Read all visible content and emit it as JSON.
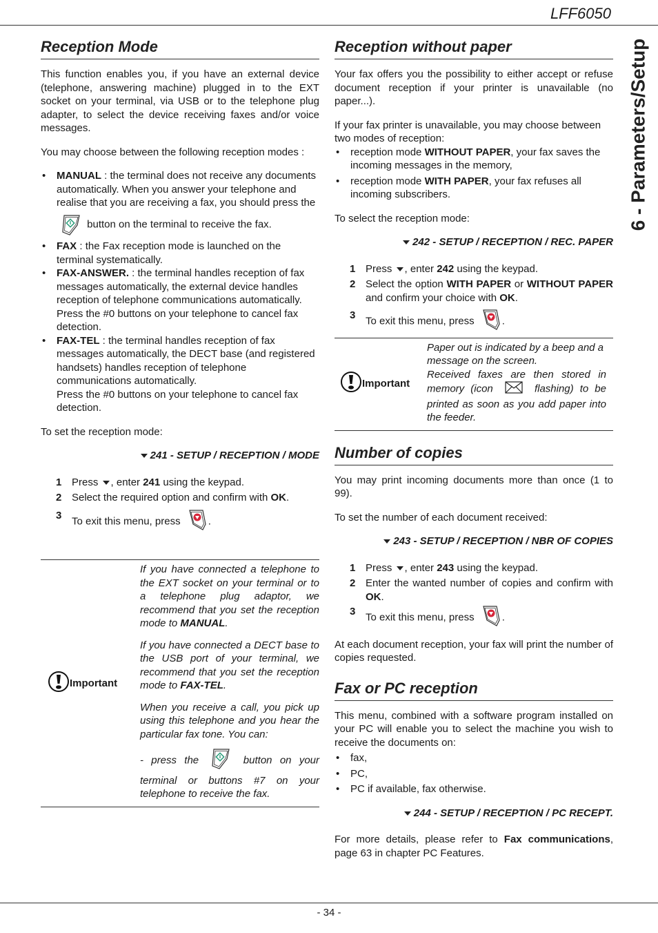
{
  "header": {
    "model": "LFF6050",
    "chapter_tab": "6 - Parameters/Setup"
  },
  "footer": {
    "page_number": "- 34 -"
  },
  "left": {
    "title": "Reception Mode",
    "intro": "This function enables you, if you have an external device (telephone, answering machine) plugged in to the EXT socket on your terminal, via USB or to the telephone plug adapter, to select the device receiving faxes and/or voice messages.",
    "choose": "You may choose between the following reception modes :",
    "modes": [
      {
        "name": "MANUAL",
        "text_a": " : the terminal does not receive any documents automatically. When you answer your telephone and realise that you are receiving a fax, you should press the",
        "text_b": " button on the terminal to receive the fax."
      },
      {
        "name": "FAX",
        "text": " : the Fax reception mode is launched on the terminal systematically."
      },
      {
        "name": "FAX-ANSWER.",
        "text": " : the terminal handles reception of fax messages automatically, the external device handles reception of telephone communications automatically. Press the #0 buttons on your telephone to cancel fax detection."
      },
      {
        "name": "FAX-TEL",
        "text": " : the terminal handles reception of fax messages automatically, the DECT base (and registered handsets) handles reception of telephone communications automatically.",
        "text2": "Press the #0 buttons on your telephone to cancel fax detection."
      }
    ],
    "set_mode": "To set the reception mode:",
    "menu_path": "241 - SETUP / RECEPTION / MODE",
    "steps": [
      {
        "n": "1",
        "a": "Press",
        "b": ", enter ",
        "bold": "241",
        "c": " using the keypad."
      },
      {
        "n": "2",
        "a": "Select the required option and confirm with ",
        "bold": "OK",
        "c": "."
      },
      {
        "n": "3",
        "a": "To exit this menu, press",
        "c": "."
      }
    ],
    "important": {
      "label": "Important",
      "p1_a": "If you have connected a telephone to the EXT socket on your terminal or to a telephone plug adaptor, we recommend that you set the reception mode to ",
      "p1_bold": "MANUAL",
      "p2_a": "If you have connected a DECT base to the USB port of your terminal, we recommend that you set the reception mode to ",
      "p2_bold": "FAX-TEL",
      "p3": "When you receive a call, you pick up using this telephone and you hear the particular fax tone. You can:",
      "p4_a": "- press the",
      "p4_b": " button on your terminal or buttons #7 on your telephone to receive the fax."
    }
  },
  "right": {
    "s1": {
      "title": "Reception without paper",
      "intro": "Your fax offers you the possibility to either accept or refuse document reception if your printer is unavailable (no paper...).",
      "choose": "If your fax printer is unavailable, you may choose between two modes of reception:",
      "opts": [
        {
          "a": "reception mode ",
          "bold": "WITHOUT PAPER",
          "c": ", your fax saves the incoming messages in the memory,"
        },
        {
          "a": "reception mode ",
          "bold": "WITH PAPER",
          "c": ", your fax refuses all incoming subscribers."
        }
      ],
      "select": "To select the reception mode:",
      "menu_path": "242 - SETUP / RECEPTION / REC. PAPER",
      "steps": [
        {
          "n": "1",
          "a": "Press",
          "b": ", enter ",
          "bold": "242",
          "c": " using the keypad."
        },
        {
          "n": "2",
          "a": "Select the option ",
          "bold1": "WITH PAPER",
          "mid": " or ",
          "bold2": "WITHOUT PAPER",
          "c1": " and confirm your choice with ",
          "bold3": "OK",
          "c": "."
        },
        {
          "n": "3",
          "a": "To exit this menu, press",
          "c": "."
        }
      ],
      "important": {
        "label": "Important",
        "l1": "Paper out is indicated by a beep and a message on the screen.",
        "l2_a": "Received faxes are then stored in memory (icon",
        "l2_b": " flashing) to be printed as soon as you add paper into the feeder."
      }
    },
    "s2": {
      "title": "Number of copies",
      "intro": "You may print incoming documents more than once (1 to 99).",
      "set": "To set the number of each document received:",
      "menu_path": "243 - SETUP / RECEPTION / NBR OF COPIES",
      "steps": [
        {
          "n": "1",
          "a": "Press",
          "b": ", enter ",
          "bold": "243",
          "c": " using the keypad."
        },
        {
          "n": "2",
          "a": "Enter the wanted number of copies and confirm with ",
          "bold": "OK",
          "c": "."
        },
        {
          "n": "3",
          "a": "To exit this menu, press",
          "c": "."
        }
      ],
      "outro": "At each document reception, your fax will print the number of copies requested."
    },
    "s3": {
      "title": "Fax or PC reception",
      "intro": "This menu, combined with a software program installed on your PC will enable you to select the machine you wish to receive the documents on:",
      "opts": [
        "fax,",
        "PC,",
        "PC if available, fax otherwise."
      ],
      "menu_path": "244 - SETUP / RECEPTION / PC RECEPT.",
      "ref_a": "For more details, please refer to ",
      "ref_bold": "Fax communications",
      "ref_c": ", page 63 in chapter PC Features."
    }
  },
  "colors": {
    "start_icon": "#2a9d7a",
    "stop_icon": "#d6263a",
    "text": "#1a1a1a"
  }
}
